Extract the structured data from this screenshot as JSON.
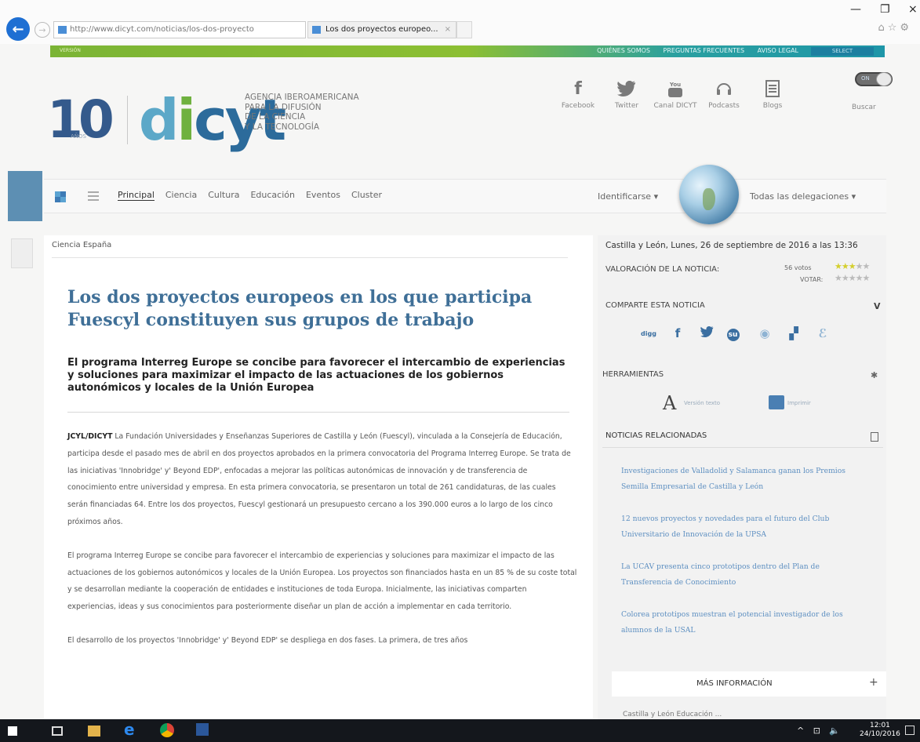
{
  "browser": {
    "address": "http://www.dicyt.com/noticias/los-dos-proyecto",
    "address_domain": "dicyt.com",
    "tab_title": "Los dos proyectos europeo...",
    "search_glyph": "⌕ ▾ ↻"
  },
  "topbar": {
    "small_text": "VERSIÓN",
    "links": [
      "QUIÉNES SOMOS",
      "PREGUNTAS FRECUENTES",
      "AVISO LEGAL"
    ],
    "language": "SELECT"
  },
  "header": {
    "years": "10",
    "years_sub": "AÑOS",
    "logo": "dicyt",
    "tagline": [
      "AGENCIA IBEROAMERICANA",
      "PARA LA DIFUSIÓN",
      "DE LA CIENCIA",
      "Y LA TECNOLOGÍA"
    ],
    "social": [
      {
        "label": "Facebook",
        "icon": "f"
      },
      {
        "label": "Twitter",
        "icon": "🐦"
      },
      {
        "label": "Canal DICYT",
        "icon": "▶"
      },
      {
        "label": "Podcasts",
        "icon": "🎧"
      },
      {
        "label": "Blogs",
        "icon": "☰"
      }
    ],
    "toggle_label": "ON",
    "search_label": "Buscar"
  },
  "nav": {
    "items": [
      "Principal",
      "Ciencia",
      "Cultura",
      "Educación",
      "Eventos",
      "Cluster"
    ],
    "identify": "Identificarse ▾",
    "delegations": "Todas las delegaciones ▾"
  },
  "article": {
    "kicker": "Ciencia España",
    "title": "Los dos proyectos europeos en los que participa Fuescyl constituyen sus grupos de trabajo",
    "subtitle": "El programa Interreg Europe se concibe para favorecer el intercambio de experiencias y soluciones para maximizar el impacto de las actuaciones de los gobiernos autonómicos y locales de la Unión Europea",
    "source": "JCYL/DICYT",
    "p1": " La Fundación Universidades y Enseñanzas Superiores de Castilla y León (Fuescyl), vinculada a la Consejería de Educación, participa desde el pasado mes de abril en dos proyectos aprobados en la primera convocatoria del Programa Interreg Europe. Se trata de las iniciativas 'Innobridge' y' Beyond EDP', enfocadas a mejorar las políticas autonómicas de innovación y de transferencia de conocimiento entre universidad y empresa. En esta primera convocatoria, se presentaron un total de 261 candidaturas, de las cuales serán financiadas 64. Entre los dos proyectos, Fuescyl gestionará un presupuesto cercano a los 390.000 euros a lo largo de los cinco próximos años.",
    "p2": "El programa Interreg Europe se concibe para favorecer el intercambio de experiencias y soluciones para maximizar el impacto de las actuaciones de los gobiernos autonómicos y locales de la Unión Europea. Los proyectos son financiados hasta en un 85 % de su coste total y se desarrollan mediante la cooperación de entidades e instituciones de toda Europa. Inicialmente, las iniciativas comparten experiencias, ideas y sus conocimientos para posteriormente diseñar un plan de acción a implementar en cada territorio.",
    "p3": "El desarrollo de los proyectos 'Innobridge' y' Beyond EDP' se despliega en dos fases. La primera, de tres años"
  },
  "sidebar": {
    "dateline": "Castilla y León, Lunes, 26 de septiembre de 2016 a las 13:36",
    "rating_label": "VALORACIÓN DE LA NOTICIA:",
    "votes": "56 votos",
    "vote_label": "VOTAR:",
    "stars_on": "★★★",
    "stars_off": "★★",
    "stars_vote": "★★★★★",
    "share_label": "COMPARTE ESTA NOTICIA",
    "share_toggle": "V",
    "share_icons": [
      "digg",
      "f",
      "t",
      "su",
      "reddit",
      "delicious",
      "meneame"
    ],
    "tools_label": "HERRAMIENTAS",
    "tool_text": "Versión texto",
    "tool_print": "Imprimir",
    "related_label": "NOTICIAS RELACIONADAS",
    "related": [
      "Investigaciones de Valladolid y Salamanca ganan los Premios Semilla Empresarial de Castilla y León",
      "12 nuevos proyectos y novedades para el futuro del Club Universitario de Innovación de la UPSA",
      "La UCAV presenta cinco prototipos dentro del Plan de Transferencia de Conocimiento",
      "Colorea prototipos muestran el potencial investigador de los alumnos de la USAL"
    ],
    "more_label": "MÁS INFORMACIÓN",
    "more_sign": "+",
    "more_next": "Castilla y León Educación ..."
  },
  "taskbar": {
    "time": "12:01",
    "date": "24/10/2016",
    "tray": "^ ⊡ 🔈"
  }
}
